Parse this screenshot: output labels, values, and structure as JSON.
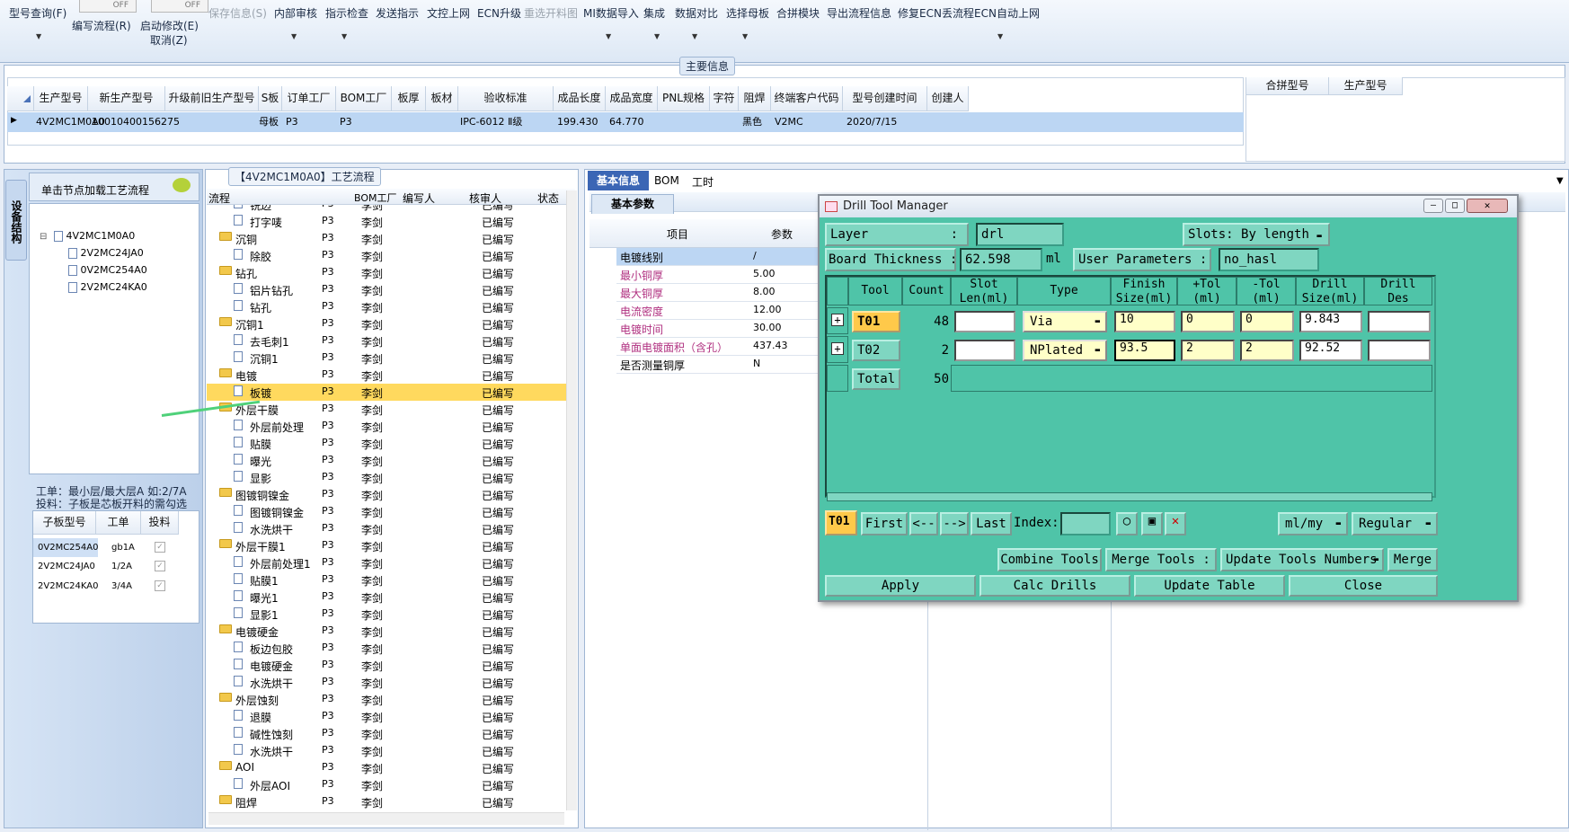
{
  "toolbar": {
    "items": [
      "型号查询(F)",
      "编写流程(R)",
      "启动修改(E)",
      "取消(Z)",
      "保存信息(S)",
      "内部审核",
      "指示检查",
      "发送指示",
      "文控上网",
      "ECN升级",
      "重选开料图",
      "MI数据导入",
      "集成",
      "数据对比",
      "选择母板",
      "合拼模块",
      "导出流程信息",
      "修复ECN丢流程",
      "ECN自动上网"
    ],
    "toggle_off": "OFF"
  },
  "main_info": {
    "title": "主要信息",
    "headers": [
      "生产型号",
      "新生产型号",
      "升级前旧生产型号",
      "S板",
      "订单工厂",
      "BOM工厂",
      "板厚",
      "板材",
      "验收标准",
      "成品长度",
      "成品宽度",
      "PNL规格",
      "字符",
      "阻焊",
      "终端客户代码",
      "型号创建时间",
      "创建人"
    ],
    "row": [
      "4V2MC1M0A0",
      "10010400156275",
      "",
      "母板",
      "P3",
      "P3",
      "",
      "",
      "IPC-6012 Ⅱ级",
      "199.430",
      "64.770",
      "",
      "",
      "黑色",
      "V2MC",
      "2020/7/15",
      ""
    ],
    "side_headers": [
      "合拼型号",
      "生产型号"
    ]
  },
  "left_panel": {
    "vtab": "设备结构",
    "load_hint": "单击节点加载工艺流程",
    "tree": [
      "4V2MC1M0A0",
      "2V2MC24JA0",
      "0V2MC254A0",
      "2V2MC24KA0"
    ],
    "note_line1": "工单：最小层/最大层A 如:2/7A",
    "note_line2": "投料：子板是芯板开料的需勾选",
    "sub_headers": [
      "子板型号",
      "工单",
      "投料"
    ],
    "sub_rows": [
      [
        "0V2MC254A0",
        "gb1A"
      ],
      [
        "2V2MC24JA0",
        "1/2A"
      ],
      [
        "2V2MC24KA0",
        "3/4A"
      ]
    ]
  },
  "flow": {
    "title": "【4V2MC1M0A0】工艺流程",
    "headers": [
      "流程",
      "BOM工厂",
      "编写人",
      "核审人",
      "状态"
    ],
    "rows": [
      {
        "name": "铣边",
        "type": "doc",
        "factory": "P3",
        "writer": "李剑",
        "status": "已编写"
      },
      {
        "name": "打字唛",
        "type": "doc",
        "factory": "P3",
        "writer": "李剑",
        "status": "已编写"
      },
      {
        "name": "沉铜",
        "type": "folder",
        "factory": "P3",
        "writer": "李剑",
        "status": "已编写"
      },
      {
        "name": "除胶",
        "type": "doc",
        "factory": "P3",
        "writer": "李剑",
        "status": "已编写"
      },
      {
        "name": "钻孔",
        "type": "folder",
        "factory": "P3",
        "writer": "李剑",
        "status": "已编写"
      },
      {
        "name": "铝片钻孔",
        "type": "doc",
        "factory": "P3",
        "writer": "李剑",
        "status": "已编写"
      },
      {
        "name": "钻孔",
        "type": "doc",
        "factory": "P3",
        "writer": "李剑",
        "status": "已编写"
      },
      {
        "name": "沉铜1",
        "type": "folder",
        "factory": "P3",
        "writer": "李剑",
        "status": "已编写"
      },
      {
        "name": "去毛刺1",
        "type": "doc",
        "factory": "P3",
        "writer": "李剑",
        "status": "已编写"
      },
      {
        "name": "沉铜1",
        "type": "doc",
        "factory": "P3",
        "writer": "李剑",
        "status": "已编写"
      },
      {
        "name": "电镀",
        "type": "folder",
        "factory": "P3",
        "writer": "李剑",
        "status": "已编写"
      },
      {
        "name": "板镀",
        "type": "doc",
        "factory": "P3",
        "writer": "李剑",
        "status": "已编写",
        "selected": true
      },
      {
        "name": "外层干膜",
        "type": "folder",
        "factory": "P3",
        "writer": "李剑",
        "status": "已编写"
      },
      {
        "name": "外层前处理",
        "type": "doc",
        "factory": "P3",
        "writer": "李剑",
        "status": "已编写"
      },
      {
        "name": "贴膜",
        "type": "doc",
        "factory": "P3",
        "writer": "李剑",
        "status": "已编写"
      },
      {
        "name": "曝光",
        "type": "doc",
        "factory": "P3",
        "writer": "李剑",
        "status": "已编写"
      },
      {
        "name": "显影",
        "type": "doc",
        "factory": "P3",
        "writer": "李剑",
        "status": "已编写"
      },
      {
        "name": "图镀铜镍金",
        "type": "folder",
        "factory": "P3",
        "writer": "李剑",
        "status": "已编写"
      },
      {
        "name": "图镀铜镍金",
        "type": "doc",
        "factory": "P3",
        "writer": "李剑",
        "status": "已编写"
      },
      {
        "name": "水洗烘干",
        "type": "doc",
        "factory": "P3",
        "writer": "李剑",
        "status": "已编写"
      },
      {
        "name": "外层干膜1",
        "type": "folder",
        "factory": "P3",
        "writer": "李剑",
        "status": "已编写"
      },
      {
        "name": "外层前处理1",
        "type": "doc",
        "factory": "P3",
        "writer": "李剑",
        "status": "已编写"
      },
      {
        "name": "贴膜1",
        "type": "doc",
        "factory": "P3",
        "writer": "李剑",
        "status": "已编写"
      },
      {
        "name": "曝光1",
        "type": "doc",
        "factory": "P3",
        "writer": "李剑",
        "status": "已编写"
      },
      {
        "name": "显影1",
        "type": "doc",
        "factory": "P3",
        "writer": "李剑",
        "status": "已编写"
      },
      {
        "name": "电镀硬金",
        "type": "folder",
        "factory": "P3",
        "writer": "李剑",
        "status": "已编写"
      },
      {
        "name": "板边包胶",
        "type": "doc",
        "factory": "P3",
        "writer": "李剑",
        "status": "已编写"
      },
      {
        "name": "电镀硬金",
        "type": "doc",
        "factory": "P3",
        "writer": "李剑",
        "status": "已编写"
      },
      {
        "name": "水洗烘干",
        "type": "doc",
        "factory": "P3",
        "writer": "李剑",
        "status": "已编写"
      },
      {
        "name": "外层蚀刻",
        "type": "folder",
        "factory": "P3",
        "writer": "李剑",
        "status": "已编写"
      },
      {
        "name": "退膜",
        "type": "doc",
        "factory": "P3",
        "writer": "李剑",
        "status": "已编写"
      },
      {
        "name": "碱性蚀刻",
        "type": "doc",
        "factory": "P3",
        "writer": "李剑",
        "status": "已编写"
      },
      {
        "name": "水洗烘干",
        "type": "doc",
        "factory": "P3",
        "writer": "李剑",
        "status": "已编写"
      },
      {
        "name": "AOI",
        "type": "folder",
        "factory": "P3",
        "writer": "李剑",
        "status": "已编写"
      },
      {
        "name": "外层AOI",
        "type": "doc",
        "factory": "P3",
        "writer": "李剑",
        "status": "已编写"
      },
      {
        "name": "阻焊",
        "type": "folder",
        "factory": "P3",
        "writer": "李剑",
        "status": "已编写"
      }
    ]
  },
  "right": {
    "tabs": [
      "基本信息",
      "BOM",
      "工时"
    ],
    "subtab": "基本参数",
    "param_headers": [
      "项目",
      "参数"
    ],
    "params": [
      {
        "k": "电镀线别",
        "v": "/"
      },
      {
        "k": "最小铜厚",
        "v": "5.00"
      },
      {
        "k": "最大铜厚",
        "v": "8.00"
      },
      {
        "k": "电流密度",
        "v": "12.00"
      },
      {
        "k": "电镀时间",
        "v": "30.00"
      },
      {
        "k": "单面电镀面积（含孔）",
        "v": "437.43"
      },
      {
        "k": "是否测量铜厚",
        "v": "N"
      }
    ]
  },
  "dialog": {
    "title": "Drill Tool Manager",
    "layer_label": "Layer",
    "colon": ":",
    "layer_value": "drl",
    "slots_label": "Slots:",
    "slots_value": "By length",
    "board_thickness_label": "Board Thickness :",
    "board_thickness_value": "62.598",
    "unit": "ml",
    "user_params_label": "User Parameters :",
    "user_params_value": "no_hasl",
    "headers": [
      "Tool",
      "Count",
      "Slot Len(ml)",
      "Type",
      "Finish Size(ml)",
      "+Tol (ml)",
      "-Tol (ml)",
      "Drill Size(ml)",
      "Drill Des"
    ],
    "rows": [
      {
        "tool": "T01",
        "count": "48",
        "type": "Via",
        "finish": "10",
        "ptol": "0",
        "mtol": "0",
        "drill": "9.843"
      },
      {
        "tool": "T02",
        "count": "2",
        "type": "NPlated",
        "finish": "93.5",
        "ptol": "2",
        "mtol": "2",
        "drill": "92.52"
      }
    ],
    "total_label": "Total",
    "total_count": "50",
    "current_tool": "T01",
    "nav": [
      "First",
      "<--",
      "-->",
      "Last"
    ],
    "index_label": "Index:",
    "unit_select": "ml/my",
    "mode_select": "Regular",
    "combine_tools": "Combine Tools",
    "merge_tools_label": "Merge Tools :",
    "update_numbers": "Update Tools Numbers",
    "merge": "Merge",
    "apply": "Apply",
    "calc": "Calc Drills",
    "update_table": "Update Table",
    "close": "Close"
  },
  "colors": {
    "dialog_bg": "#4fc4a8",
    "selected_row": "#ffd95e",
    "tool_button": "#ffc94a"
  }
}
